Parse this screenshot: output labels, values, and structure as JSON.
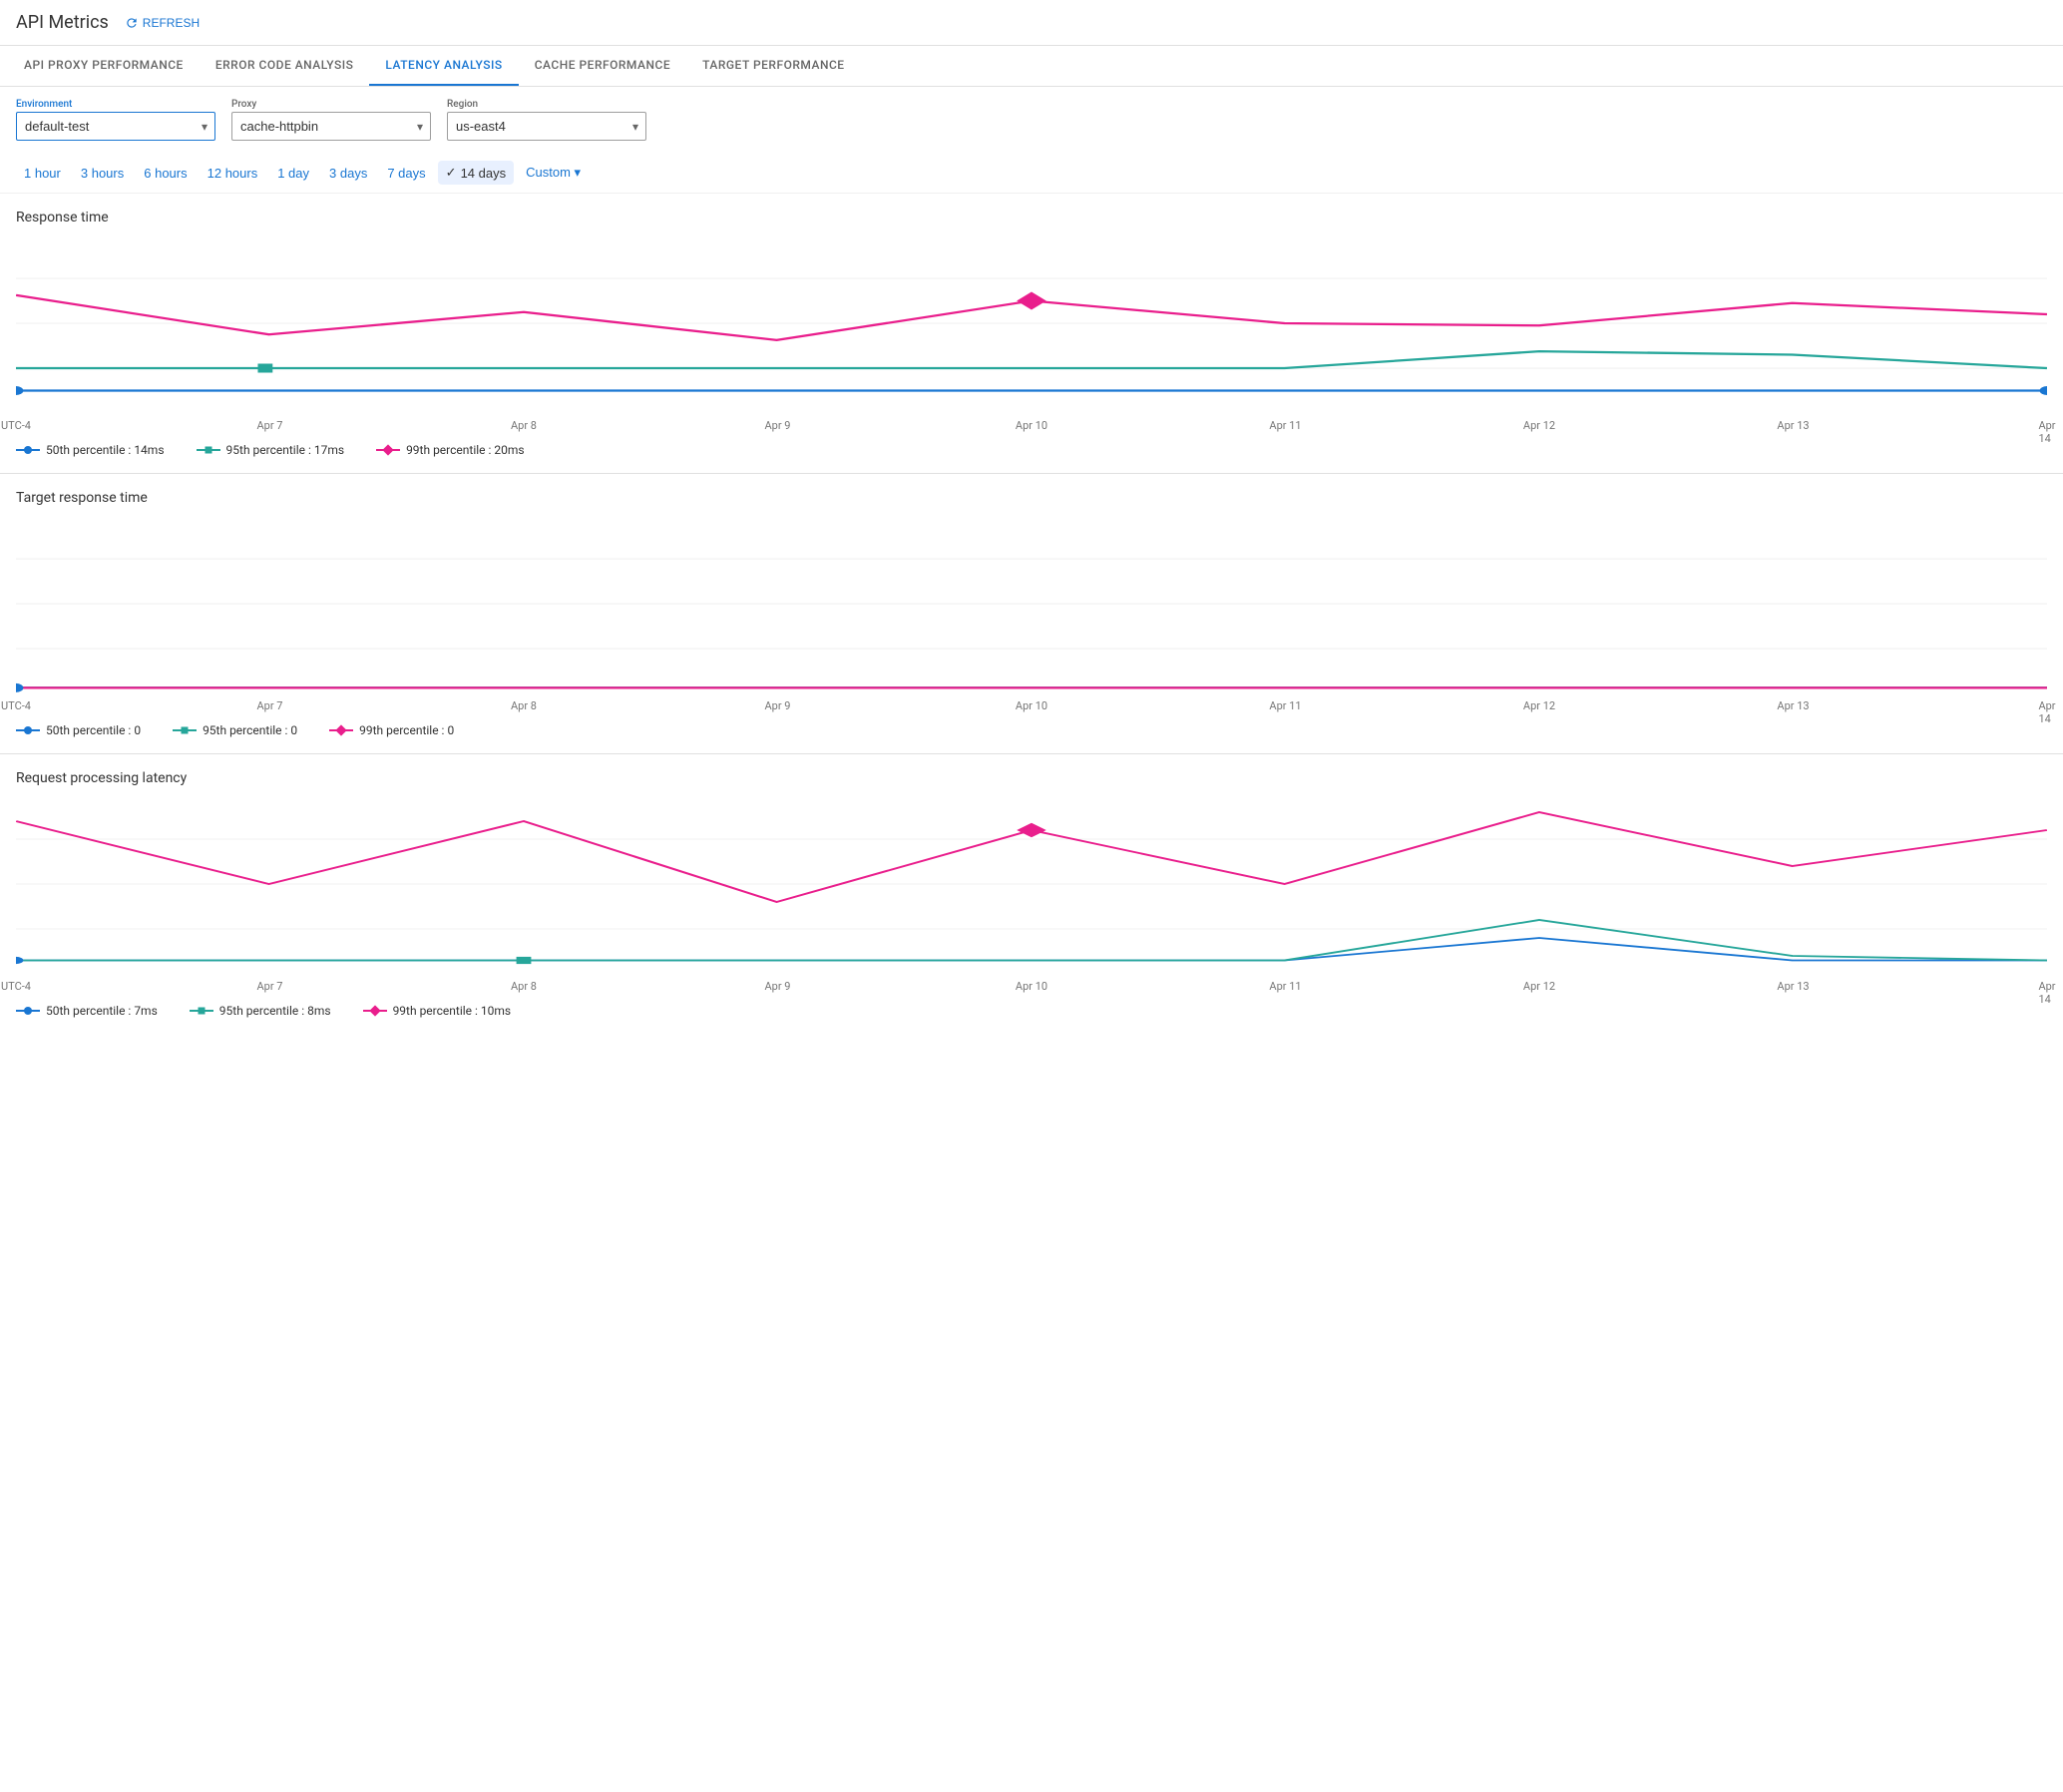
{
  "header": {
    "title": "API Metrics",
    "refresh_label": "REFRESH"
  },
  "tabs": [
    {
      "id": "api-proxy",
      "label": "API PROXY PERFORMANCE",
      "active": false
    },
    {
      "id": "error-code",
      "label": "ERROR CODE ANALYSIS",
      "active": false
    },
    {
      "id": "latency",
      "label": "LATENCY ANALYSIS",
      "active": true
    },
    {
      "id": "cache",
      "label": "CACHE PERFORMANCE",
      "active": false
    },
    {
      "id": "target",
      "label": "TARGET PERFORMANCE",
      "active": false
    }
  ],
  "filters": {
    "environment": {
      "label": "Environment",
      "value": "default-test",
      "options": [
        "default-test"
      ]
    },
    "proxy": {
      "label": "Proxy",
      "value": "cache-httpbin",
      "options": [
        "cache-httpbin"
      ]
    },
    "region": {
      "label": "Region",
      "value": "us-east4",
      "options": [
        "us-east4"
      ]
    }
  },
  "time_filters": {
    "options": [
      "1 hour",
      "3 hours",
      "6 hours",
      "12 hours",
      "1 day",
      "3 days",
      "7 days",
      "14 days",
      "Custom"
    ],
    "active": "14 days"
  },
  "charts": {
    "response_time": {
      "title": "Response time",
      "x_labels": [
        "UTC-4",
        "Apr 7",
        "Apr 8",
        "Apr 9",
        "Apr 10",
        "Apr 11",
        "Apr 12",
        "Apr 13",
        "Apr 14"
      ],
      "legend": [
        {
          "label": "50th percentile : 14ms",
          "color": "blue",
          "type": "circle"
        },
        {
          "label": "95th percentile : 17ms",
          "color": "teal",
          "type": "square"
        },
        {
          "label": "99th percentile : 20ms",
          "color": "pink",
          "type": "diamond"
        }
      ]
    },
    "target_response_time": {
      "title": "Target response time",
      "x_labels": [
        "UTC-4",
        "Apr 7",
        "Apr 8",
        "Apr 9",
        "Apr 10",
        "Apr 11",
        "Apr 12",
        "Apr 13",
        "Apr 14"
      ],
      "legend": [
        {
          "label": "50th percentile : 0",
          "color": "blue",
          "type": "circle"
        },
        {
          "label": "95th percentile : 0",
          "color": "teal",
          "type": "square"
        },
        {
          "label": "99th percentile : 0",
          "color": "pink",
          "type": "diamond"
        }
      ]
    },
    "request_processing": {
      "title": "Request processing latency",
      "x_labels": [
        "UTC-4",
        "Apr 7",
        "Apr 8",
        "Apr 9",
        "Apr 10",
        "Apr 11",
        "Apr 12",
        "Apr 13",
        "Apr 14"
      ],
      "legend": [
        {
          "label": "50th percentile : 7ms",
          "color": "blue",
          "type": "circle"
        },
        {
          "label": "95th percentile : 8ms",
          "color": "teal",
          "type": "square"
        },
        {
          "label": "99th percentile : 10ms",
          "color": "pink",
          "type": "diamond"
        }
      ]
    }
  },
  "colors": {
    "blue": "#1976d2",
    "teal": "#26a69a",
    "pink": "#e91e8c",
    "active_tab": "#1976d2",
    "border": "#e0e0e0"
  }
}
